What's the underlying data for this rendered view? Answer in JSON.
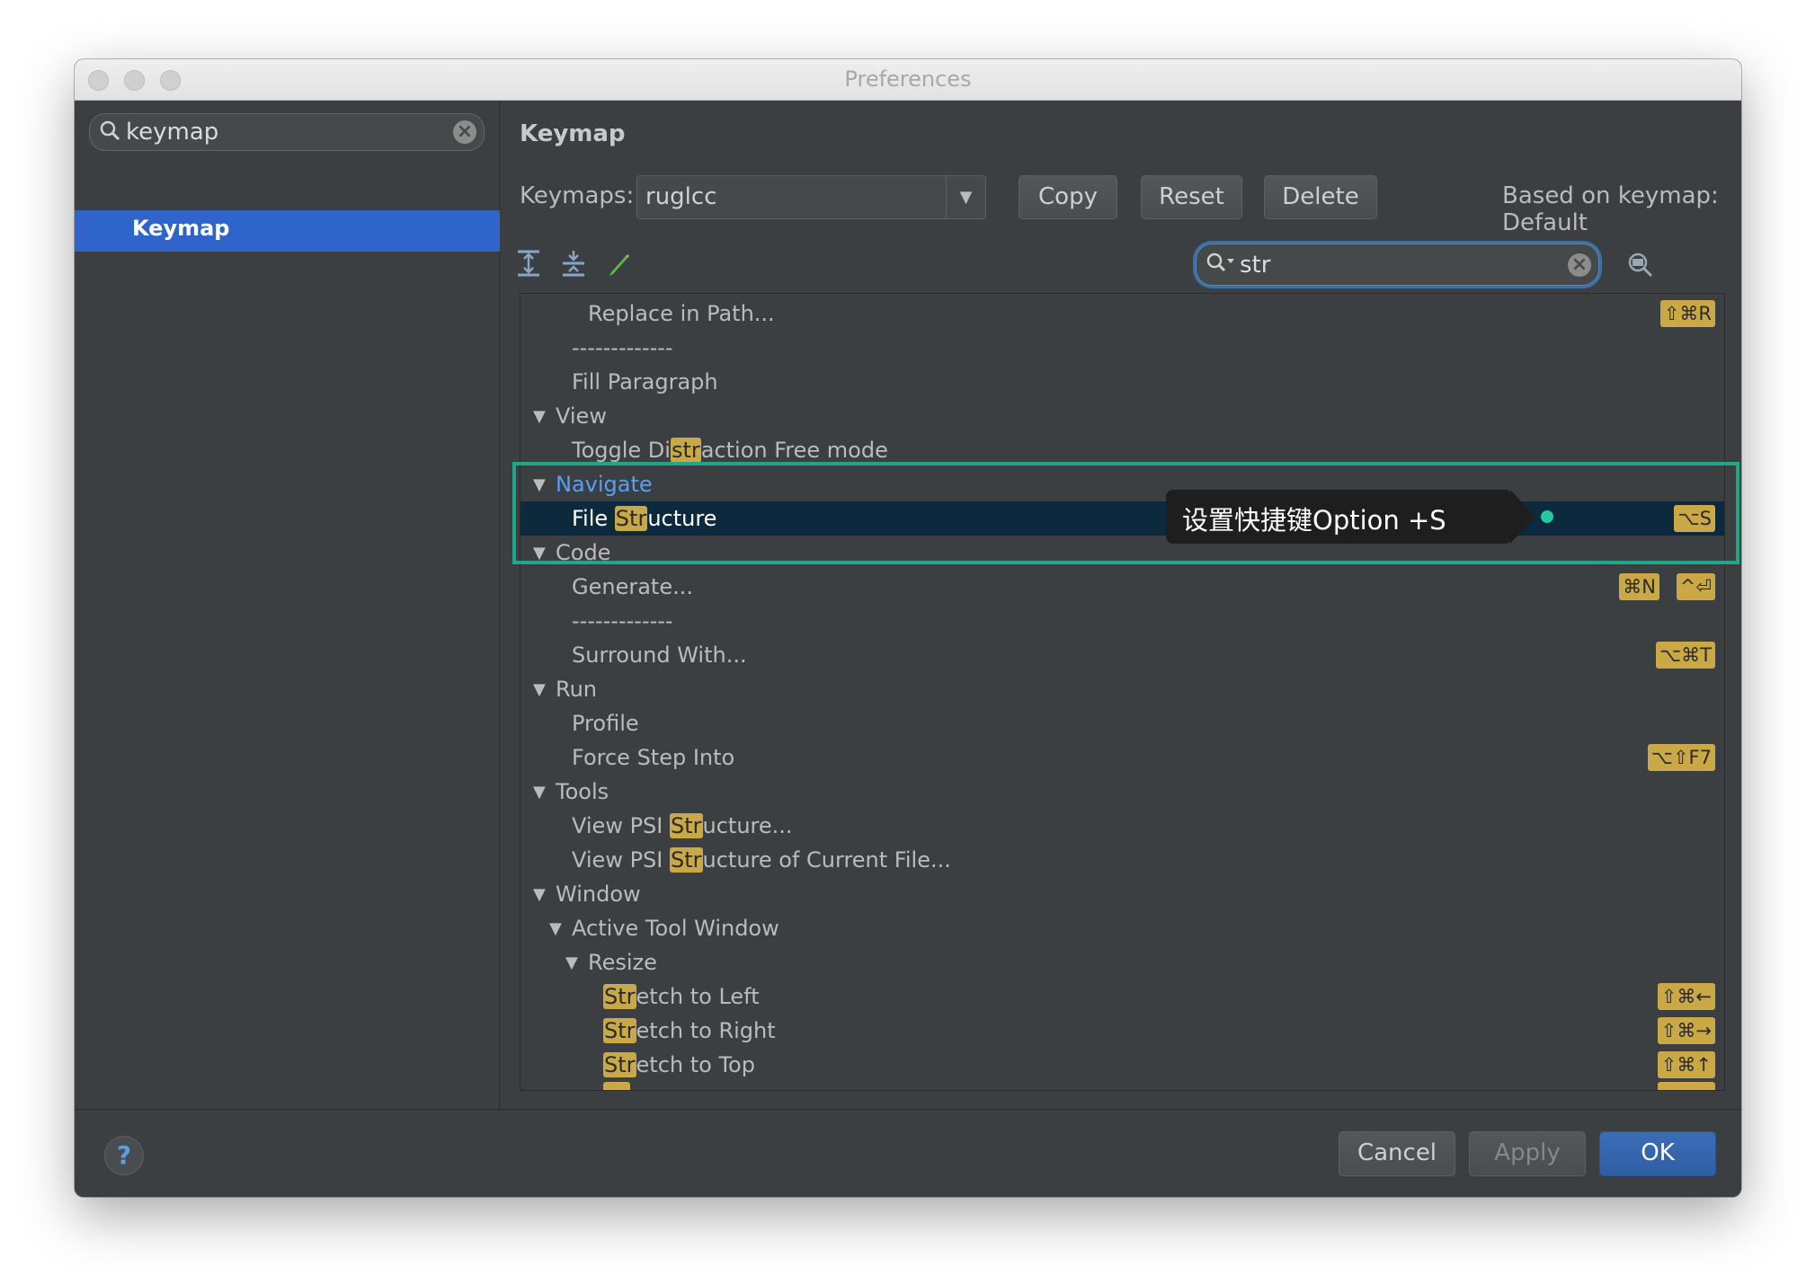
{
  "window": {
    "title": "Preferences"
  },
  "sidebar": {
    "search_value": "keymap",
    "items": [
      {
        "label": "Keymap",
        "selected": true
      }
    ]
  },
  "main": {
    "title": "Keymap",
    "keymaps_label": "Keymaps:",
    "keymap_value": "ruglcc",
    "copy_label": "Copy",
    "reset_label": "Reset",
    "delete_label": "Delete",
    "based_on": "Based on keymap: Default",
    "filter_value": "str"
  },
  "tree": [
    {
      "text": "Replace in Path...",
      "shortcut": "⇧⌘R"
    },
    {
      "text": "-------------"
    },
    {
      "text": "Fill Paragraph"
    },
    {
      "text": "View",
      "group": true
    },
    {
      "pre": "Toggle Di",
      "hl": "str",
      "post": "action Free mode"
    },
    {
      "text": "Navigate",
      "group": true
    },
    {
      "pre": "File ",
      "hl": "Str",
      "post": "ucture",
      "shortcut": "⌥S"
    },
    {
      "text": "Code",
      "group": true
    },
    {
      "text": "Generate...",
      "shortcut": "⌘N",
      "shortcut2": "^⏎"
    },
    {
      "text": "-------------"
    },
    {
      "text": "Surround With...",
      "shortcut": "⌥⌘T"
    },
    {
      "text": "Run",
      "group": true
    },
    {
      "text": "Profile"
    },
    {
      "text": "Force Step Into",
      "shortcut": "⌥⇧F7"
    },
    {
      "text": "Tools",
      "group": true
    },
    {
      "pre": "View PSI ",
      "hl": "Str",
      "post": "ucture..."
    },
    {
      "pre": "View PSI ",
      "hl": "Str",
      "post": "ucture of Current File..."
    },
    {
      "text": "Window",
      "group": true
    },
    {
      "text": "Active Tool Window",
      "group": true
    },
    {
      "text": "Resize",
      "group": true
    },
    {
      "hl": "Str",
      "post": "etch to Left",
      "shortcut": "⇧⌘←"
    },
    {
      "hl": "Str",
      "post": "etch to Right",
      "shortcut": "⇧⌘→"
    },
    {
      "hl": "Str",
      "post": "etch to Top",
      "shortcut": "⇧⌘↑"
    }
  ],
  "callout": {
    "text": "设置快捷键Option +S"
  },
  "footer": {
    "cancel": "Cancel",
    "apply": "Apply",
    "ok": "OK",
    "help": "?"
  },
  "colors": {
    "accent": "#2f65ca",
    "highlight": "#c9a845",
    "annotation": "#1da88a"
  }
}
